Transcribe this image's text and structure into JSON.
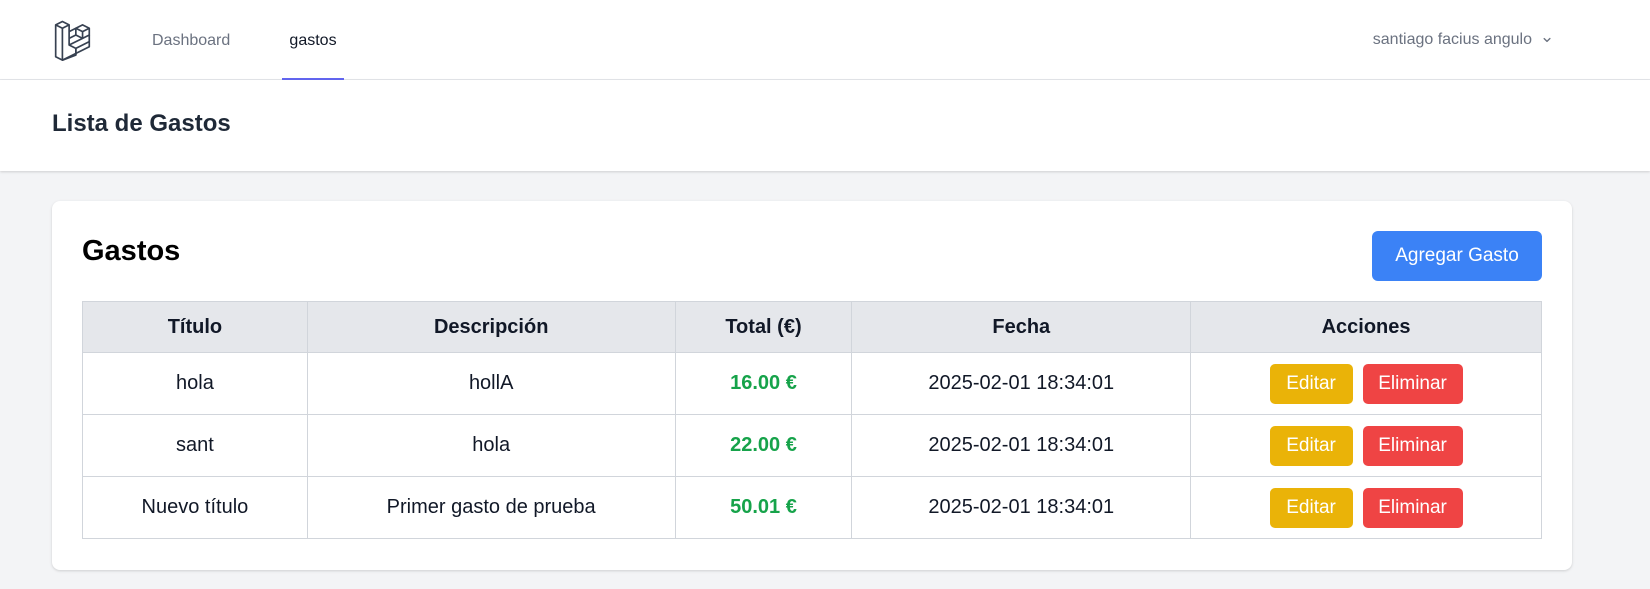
{
  "nav": {
    "links": [
      {
        "label": "Dashboard"
      },
      {
        "label": "gastos"
      }
    ],
    "user_name": "santiago facius angulo"
  },
  "header": {
    "title": "Lista de Gastos"
  },
  "card": {
    "title": "Gastos",
    "add_button_label": "Agregar Gasto"
  },
  "table": {
    "headers": [
      "Título",
      "Descripción",
      "Total (€)",
      "Fecha",
      "Acciones"
    ],
    "rows": [
      {
        "titulo": "hola",
        "descripcion": "hollA",
        "total": "16.00 €",
        "fecha": "2025-02-01 18:34:01",
        "edit_label": "Editar",
        "delete_label": "Eliminar"
      },
      {
        "titulo": "sant",
        "descripcion": "hola",
        "total": "22.00 €",
        "fecha": "2025-02-01 18:34:01",
        "edit_label": "Editar",
        "delete_label": "Eliminar"
      },
      {
        "titulo": "Nuevo título",
        "descripcion": "Primer gasto de prueba",
        "total": "50.01 €",
        "fecha": "2025-02-01 18:34:01",
        "edit_label": "Editar",
        "delete_label": "Eliminar"
      }
    ]
  },
  "colors": {
    "primary": "#3b82f6",
    "edit": "#eab308",
    "delete": "#ef4444",
    "total_text": "#16a34a",
    "active_nav_underline": "#6366f1"
  },
  "icons": {
    "logo": "laravel-logo-icon",
    "user_menu": "chevron-down-icon"
  }
}
